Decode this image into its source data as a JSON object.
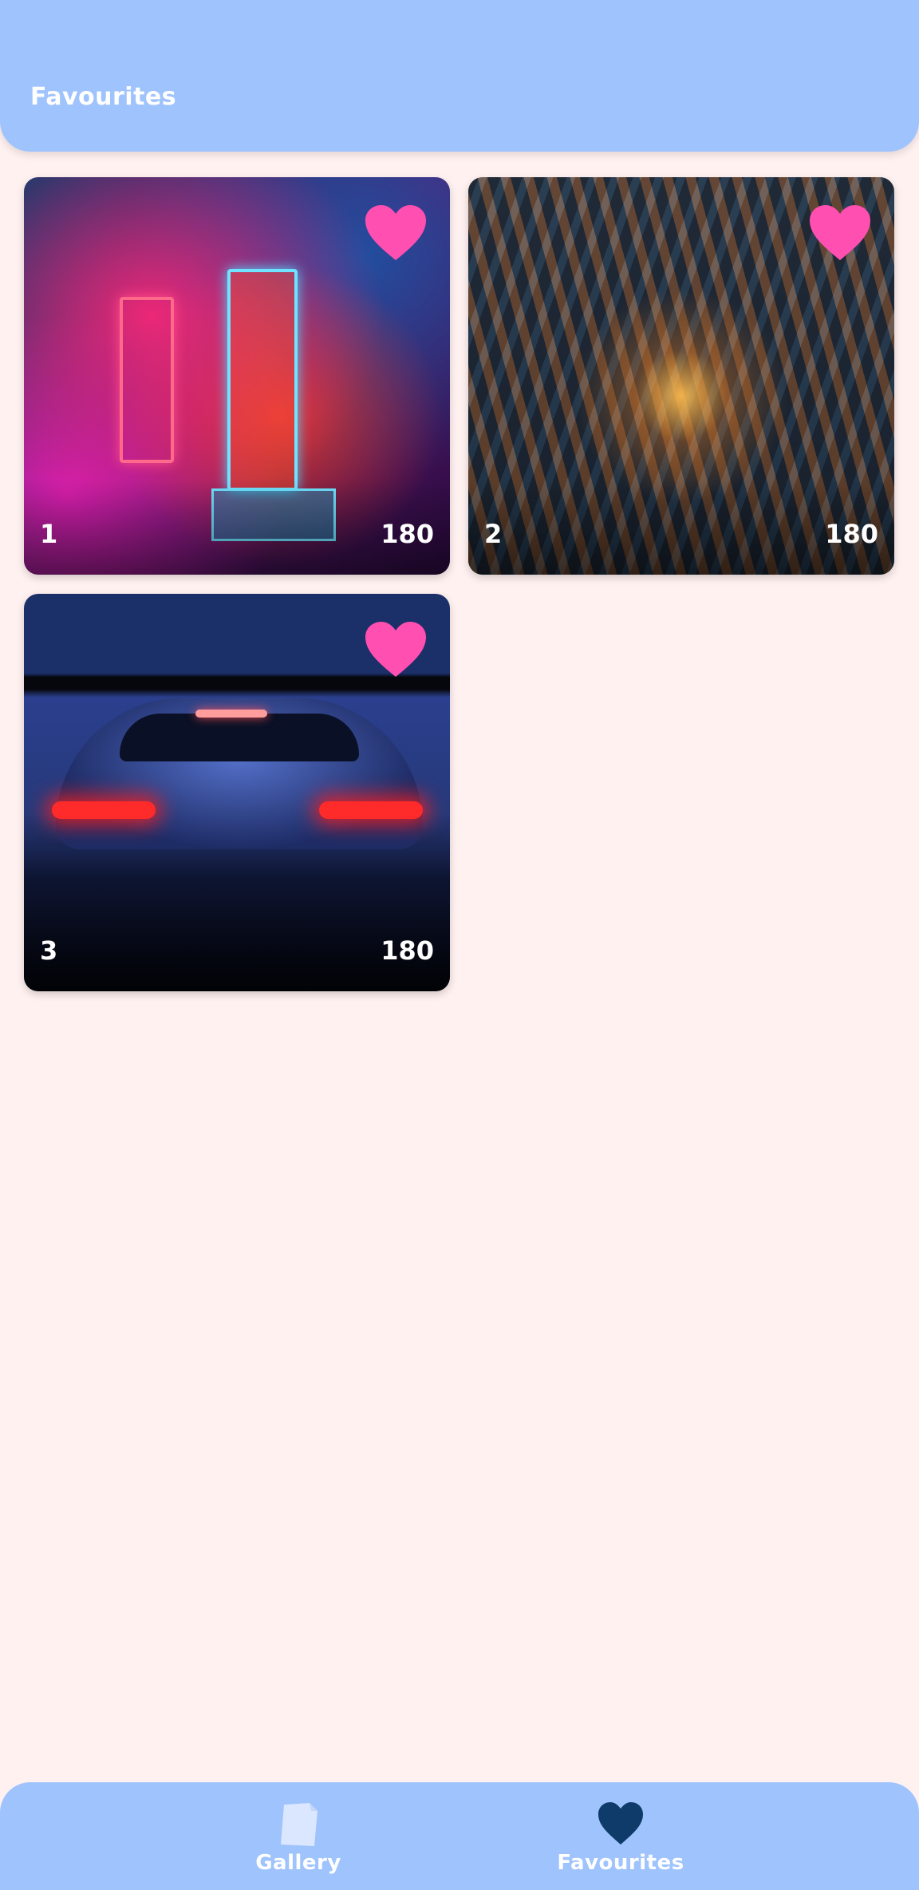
{
  "header": {
    "title": "Favourites"
  },
  "favourites": [
    {
      "title": "1",
      "count": "180",
      "favourited": true,
      "heart_icon": "heart-icon"
    },
    {
      "title": "2",
      "count": "180",
      "favourited": true,
      "heart_icon": "heart-icon"
    },
    {
      "title": "3",
      "count": "180",
      "favourited": true,
      "heart_icon": "heart-icon"
    }
  ],
  "bottom_nav": {
    "items": [
      {
        "label": "Gallery",
        "icon": "gallery-icon",
        "active": false
      },
      {
        "label": "Favourites",
        "icon": "heart-icon",
        "active": true
      }
    ]
  },
  "colors": {
    "app_bar": "#9fc3fd",
    "background": "#fff1f0",
    "heart": "#ff4fb0",
    "active_nav_icon": "#0e3b6a",
    "inactive_nav_icon": "#dbe7ff"
  }
}
